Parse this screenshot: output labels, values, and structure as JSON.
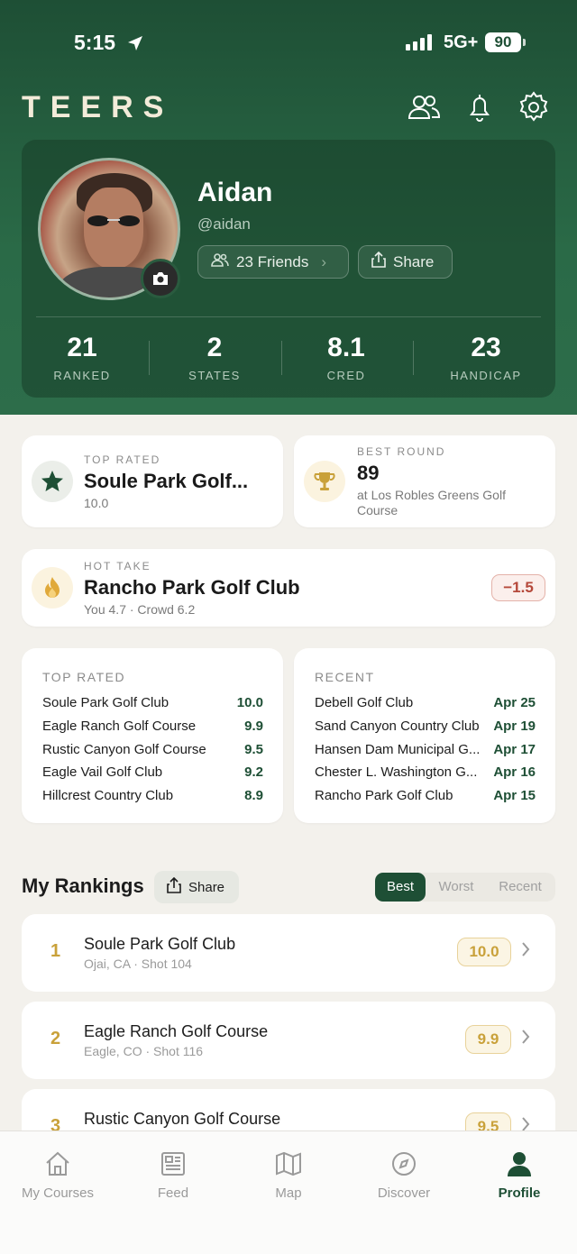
{
  "status": {
    "time": "5:15",
    "network": "5G+",
    "battery": "90"
  },
  "brand": "TEERS",
  "profile": {
    "name": "Aidan",
    "handle": "@aidan",
    "friends_label": "23 Friends",
    "share_label": "Share",
    "stats": [
      {
        "value": "21",
        "label": "RANKED"
      },
      {
        "value": "2",
        "label": "STATES"
      },
      {
        "value": "8.1",
        "label": "CRED"
      },
      {
        "value": "23",
        "label": "HANDICAP"
      }
    ]
  },
  "highlights": {
    "top_rated": {
      "kicker": "TOP RATED",
      "title": "Soule Park Golf...",
      "sub": "10.0"
    },
    "best_round": {
      "kicker": "BEST ROUND",
      "title": "89",
      "sub": "at Los Robles Greens Golf Course"
    },
    "hot_take": {
      "kicker": "HOT TAKE",
      "title": "Rancho Park Golf Club",
      "sub": "You 4.7 · Crowd 6.2",
      "delta": "−1.5"
    }
  },
  "top_rated_list": {
    "title": "TOP RATED",
    "rows": [
      {
        "name": "Soule Park Golf Club",
        "value": "10.0"
      },
      {
        "name": "Eagle Ranch Golf Course",
        "value": "9.9"
      },
      {
        "name": "Rustic Canyon Golf Course",
        "value": "9.5"
      },
      {
        "name": "Eagle Vail Golf Club",
        "value": "9.2"
      },
      {
        "name": "Hillcrest Country Club",
        "value": "8.9"
      }
    ]
  },
  "recent_list": {
    "title": "RECENT",
    "rows": [
      {
        "name": "Debell Golf Club",
        "value": "Apr 25"
      },
      {
        "name": "Sand Canyon Country Club",
        "value": "Apr 19"
      },
      {
        "name": "Hansen Dam Municipal G...",
        "value": "Apr 17"
      },
      {
        "name": "Chester L. Washington G...",
        "value": "Apr 16"
      },
      {
        "name": "Rancho Park Golf Club",
        "value": "Apr 15"
      }
    ]
  },
  "rankings": {
    "title": "My Rankings",
    "share_label": "Share",
    "tabs": [
      "Best",
      "Worst",
      "Recent"
    ],
    "active_tab": "Best",
    "items": [
      {
        "rank": "1",
        "name": "Soule Park Golf Club",
        "meta": "Ojai, CA · Shot 104",
        "score": "10.0"
      },
      {
        "rank": "2",
        "name": "Eagle Ranch Golf Course",
        "meta": "Eagle, CO · Shot 116",
        "score": "9.9"
      },
      {
        "rank": "3",
        "name": "Rustic Canyon Golf Course",
        "meta": "",
        "score": "9.5"
      }
    ]
  },
  "tabbar": [
    {
      "label": "My Courses",
      "icon": "home-icon"
    },
    {
      "label": "Feed",
      "icon": "newspaper-icon"
    },
    {
      "label": "Map",
      "icon": "map-icon"
    },
    {
      "label": "Discover",
      "icon": "compass-icon"
    },
    {
      "label": "Profile",
      "icon": "person-icon"
    }
  ],
  "colors": {
    "brand_green": "#1e4f35",
    "gold": "#c9a13a",
    "negative": "#b5483a"
  }
}
